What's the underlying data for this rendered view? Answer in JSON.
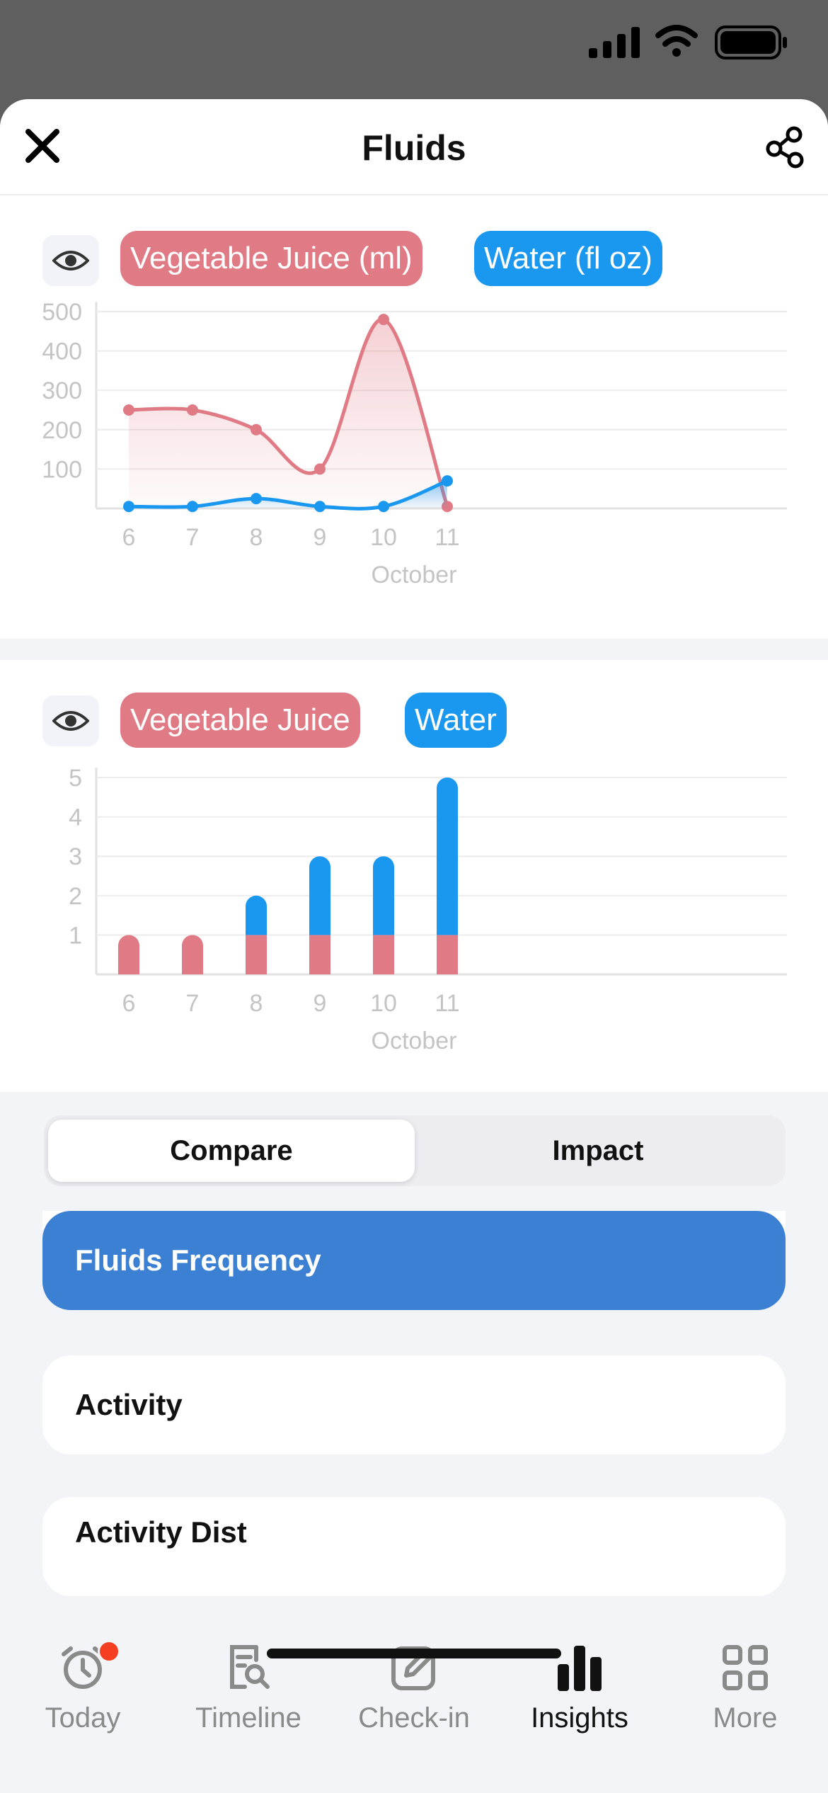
{
  "header": {
    "title": "Fluids",
    "close_icon": "close-icon",
    "share_icon": "share-icon"
  },
  "colors": {
    "juice": "#e07a85",
    "water": "#1a98f0",
    "accent": "#3b80d3",
    "badge": "#f43f22"
  },
  "card1": {
    "legend": [
      "Vegetable Juice (ml)",
      "Water (fl oz)"
    ]
  },
  "card2": {
    "legend": [
      "Vegetable Juice",
      "Water"
    ]
  },
  "chart_data": [
    {
      "type": "area",
      "categories": [
        "6",
        "7",
        "8",
        "9",
        "10",
        "11"
      ],
      "xlabel": "October",
      "ylim": [
        0,
        500
      ],
      "yticks": [
        "100",
        "200",
        "300",
        "400",
        "500"
      ],
      "grid": true,
      "series": [
        {
          "name": "Vegetable Juice (ml)",
          "values": [
            250,
            250,
            200,
            100,
            480,
            5
          ]
        },
        {
          "name": "Water (fl oz)",
          "values": [
            5,
            5,
            25,
            5,
            5,
            70
          ]
        }
      ]
    },
    {
      "type": "bar",
      "stacked": true,
      "categories": [
        "6",
        "7",
        "8",
        "9",
        "10",
        "11"
      ],
      "xlabel": "October",
      "ylim": [
        0,
        5
      ],
      "yticks": [
        "1",
        "2",
        "3",
        "4",
        "5"
      ],
      "grid": true,
      "series": [
        {
          "name": "Vegetable Juice",
          "values": [
            1,
            1,
            1,
            1,
            1,
            1
          ]
        },
        {
          "name": "Water",
          "values": [
            0,
            0,
            1,
            2,
            2,
            4
          ]
        }
      ]
    }
  ],
  "segmented": {
    "compare": "Compare",
    "impact": "Impact"
  },
  "list": {
    "items": [
      {
        "label": ""
      },
      {
        "label": "Fluids Frequency"
      },
      {
        "label": "Activity"
      },
      {
        "label": "Activity Dist"
      }
    ]
  },
  "tabs": [
    {
      "label": "Today",
      "icon": "alarm-clock-icon"
    },
    {
      "label": "Timeline",
      "icon": "timeline-search-icon"
    },
    {
      "label": "Check-in",
      "icon": "edit-icon"
    },
    {
      "label": "Insights",
      "icon": "bar-chart-icon"
    },
    {
      "label": "More",
      "icon": "grid-icon"
    }
  ]
}
